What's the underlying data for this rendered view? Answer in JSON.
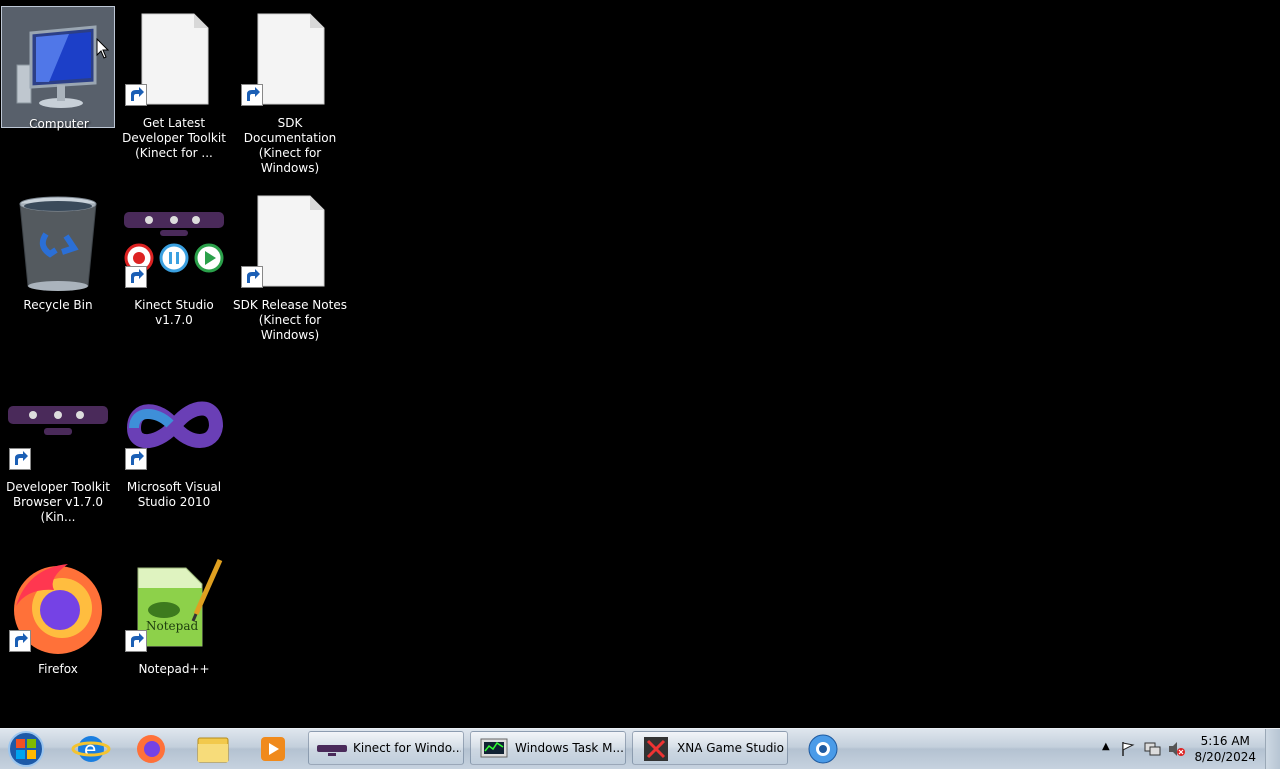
{
  "desktop": {
    "icons": [
      {
        "label": "Computer",
        "icon": "computer-icon"
      },
      {
        "label": "Get Latest Developer Toolkit (Kinect for ...",
        "icon": "document-icon"
      },
      {
        "label": "SDK Documentation (Kinect for Windows)",
        "icon": "document-icon"
      },
      {
        "label": "Recycle Bin",
        "icon": "recycle-bin-icon"
      },
      {
        "label": "Kinect Studio v1.7.0",
        "icon": "kinect-studio-icon"
      },
      {
        "label": "SDK Release Notes (Kinect for Windows)",
        "icon": "document-icon"
      },
      {
        "label": "Developer Toolkit Browser v1.7.0 (Kin...",
        "icon": "kinect-sensor-icon"
      },
      {
        "label": "Microsoft Visual Studio 2010",
        "icon": "visual-studio-icon"
      },
      {
        "label": "Firefox",
        "icon": "firefox-icon"
      },
      {
        "label": "Notepad++",
        "icon": "notepad-plus-plus-icon"
      }
    ]
  },
  "taskbar": {
    "pinned": [
      "internet-explorer-icon",
      "firefox-icon",
      "windows-explorer-icon",
      "media-player-icon"
    ],
    "tasks": [
      {
        "label": "Kinect for Windo...",
        "icon": "kinect-sensor-icon"
      },
      {
        "label": "Windows Task M...",
        "icon": "task-manager-icon"
      },
      {
        "label": "XNA Game Studio...",
        "icon": "xna-icon"
      }
    ],
    "extra_pinned": "chrome-like-globe-icon",
    "clock": {
      "time": "5:16 AM",
      "date": "8/20/2024"
    }
  },
  "colors": {
    "desktop_background": "#000000",
    "taskbar": "#c3cfdc",
    "kinect_purple": "#4a2a5a"
  }
}
